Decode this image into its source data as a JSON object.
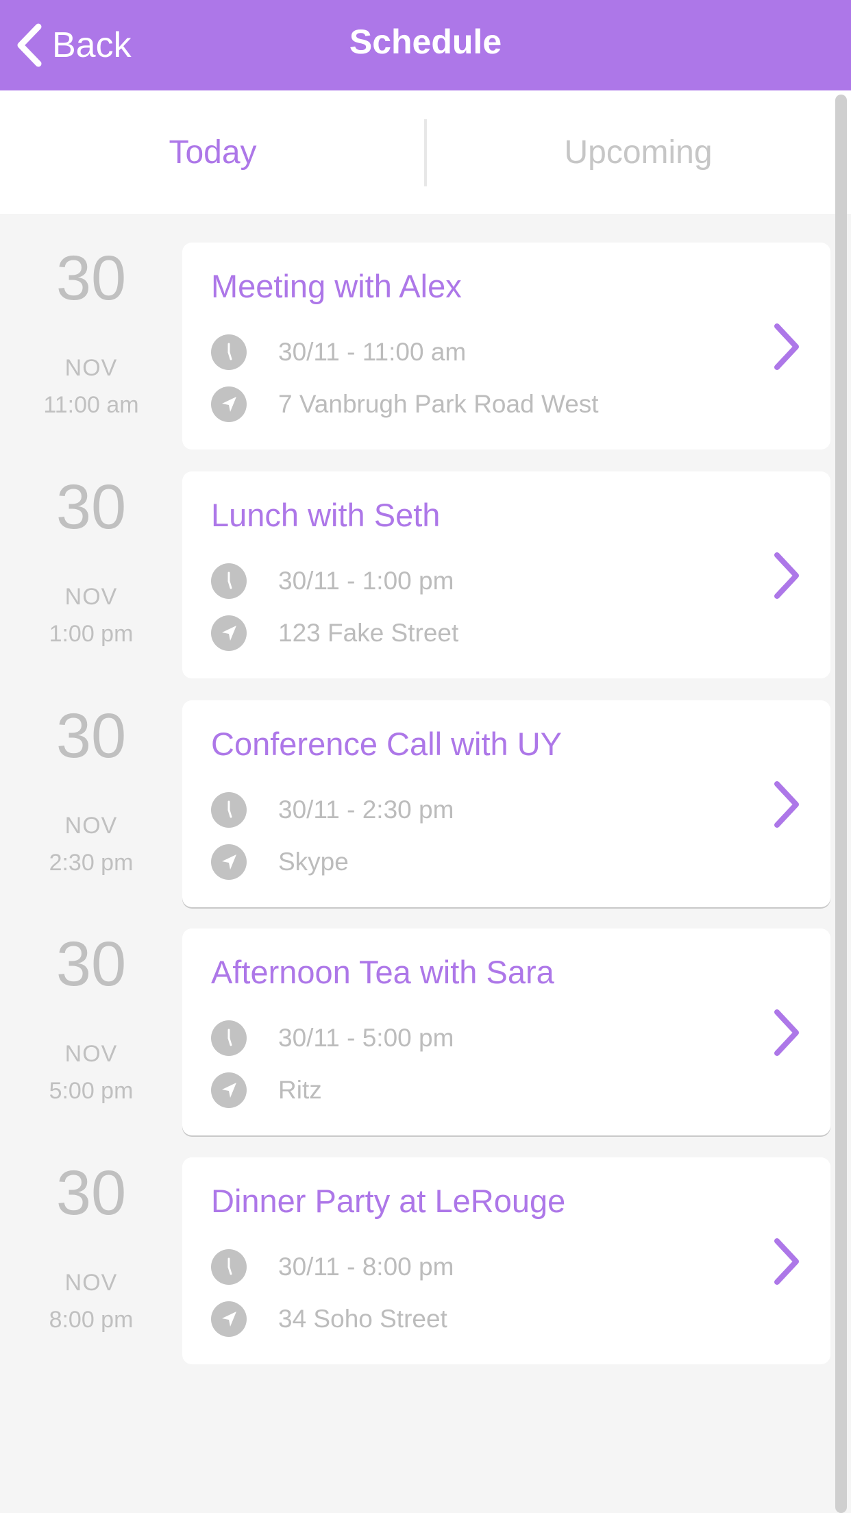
{
  "header": {
    "back_label": "Back",
    "title": "Schedule"
  },
  "tabs": [
    {
      "label": "Today",
      "active": true
    },
    {
      "label": "Upcoming",
      "active": false
    }
  ],
  "colors": {
    "accent": "#ad77e8",
    "muted_text": "#bcbcbc",
    "background": "#f5f5f5"
  },
  "events": [
    {
      "day": "30",
      "month": "NOV",
      "time": "11:00 am",
      "title": "Meeting with Alex",
      "datetime": "30/11 - 11:00 am",
      "location": "7 Vanbrugh Park Road West"
    },
    {
      "day": "30",
      "month": "NOV",
      "time": "1:00 pm",
      "title": "Lunch with Seth",
      "datetime": "30/11 - 1:00 pm",
      "location": "123 Fake Street"
    },
    {
      "day": "30",
      "month": "NOV",
      "time": "2:30 pm",
      "title": "Conference Call with UY",
      "datetime": "30/11 - 2:30 pm",
      "location": "Skype"
    },
    {
      "day": "30",
      "month": "NOV",
      "time": "5:00 pm",
      "title": "Afternoon Tea with Sara",
      "datetime": "30/11 - 5:00 pm",
      "location": "Ritz"
    },
    {
      "day": "30",
      "month": "NOV",
      "time": "8:00 pm",
      "title": "Dinner Party at LeRouge",
      "datetime": "30/11 - 8:00 pm",
      "location": "34 Soho Street"
    }
  ]
}
